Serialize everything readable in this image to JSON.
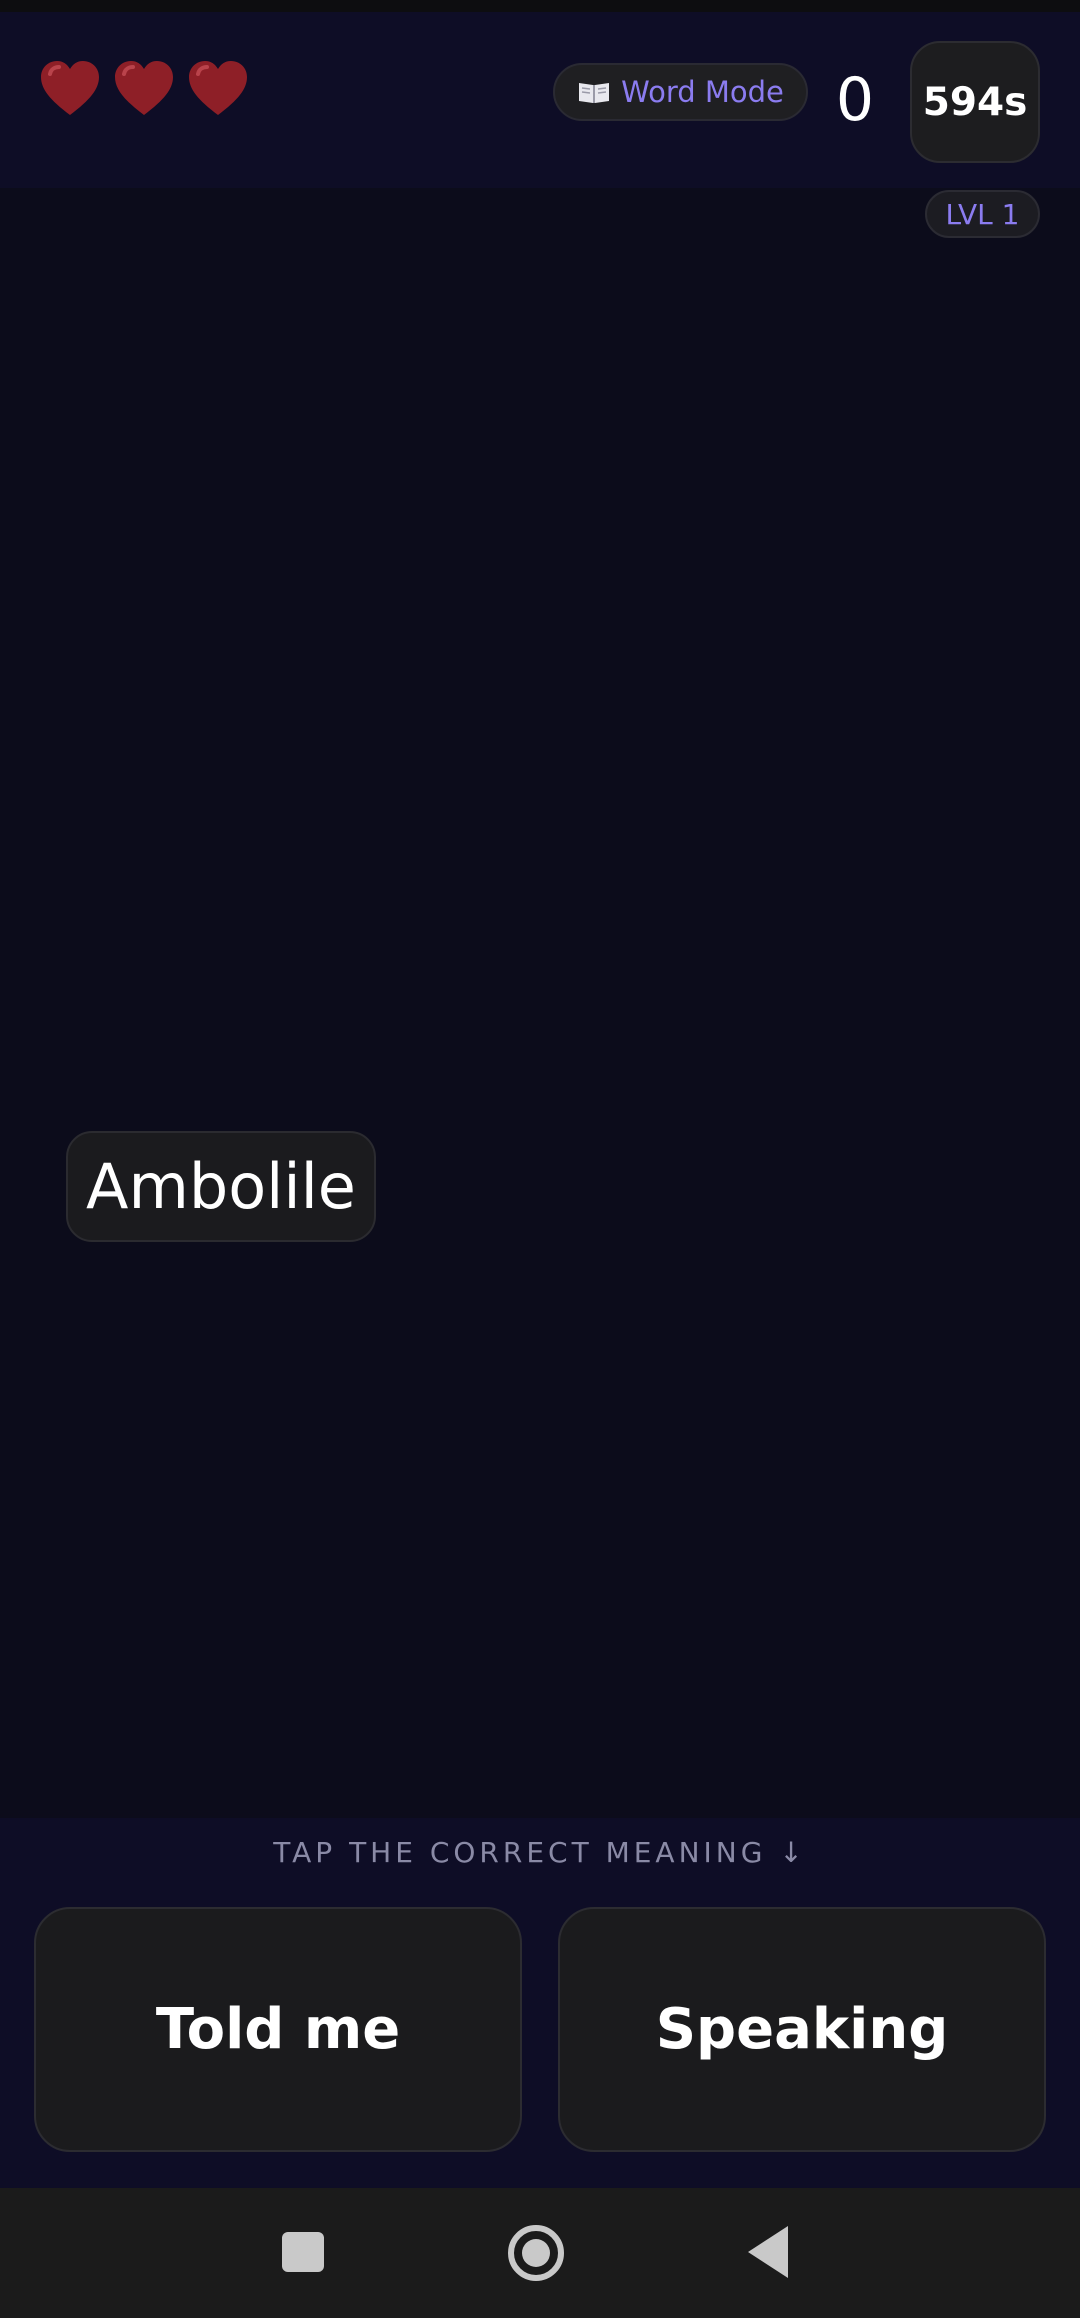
{
  "hud": {
    "lives": 3,
    "lives_max": 3,
    "mode_label": "Word Mode",
    "mode_icon": "open-book-icon",
    "score": "0",
    "timer": "594s",
    "level": "LVL 1"
  },
  "question": {
    "word": "Ambolile"
  },
  "answers": {
    "prompt": "TAP THE CORRECT MEANING ↓",
    "options": [
      "Told me",
      "Speaking"
    ]
  },
  "colors": {
    "background": "#0c0c1b",
    "panel": "#0e0d26",
    "accent": "#8b7cf0",
    "heart": "#8e1f27"
  },
  "navbar": {
    "icons": [
      "recents-square-icon",
      "home-circle-icon",
      "back-triangle-icon"
    ]
  }
}
